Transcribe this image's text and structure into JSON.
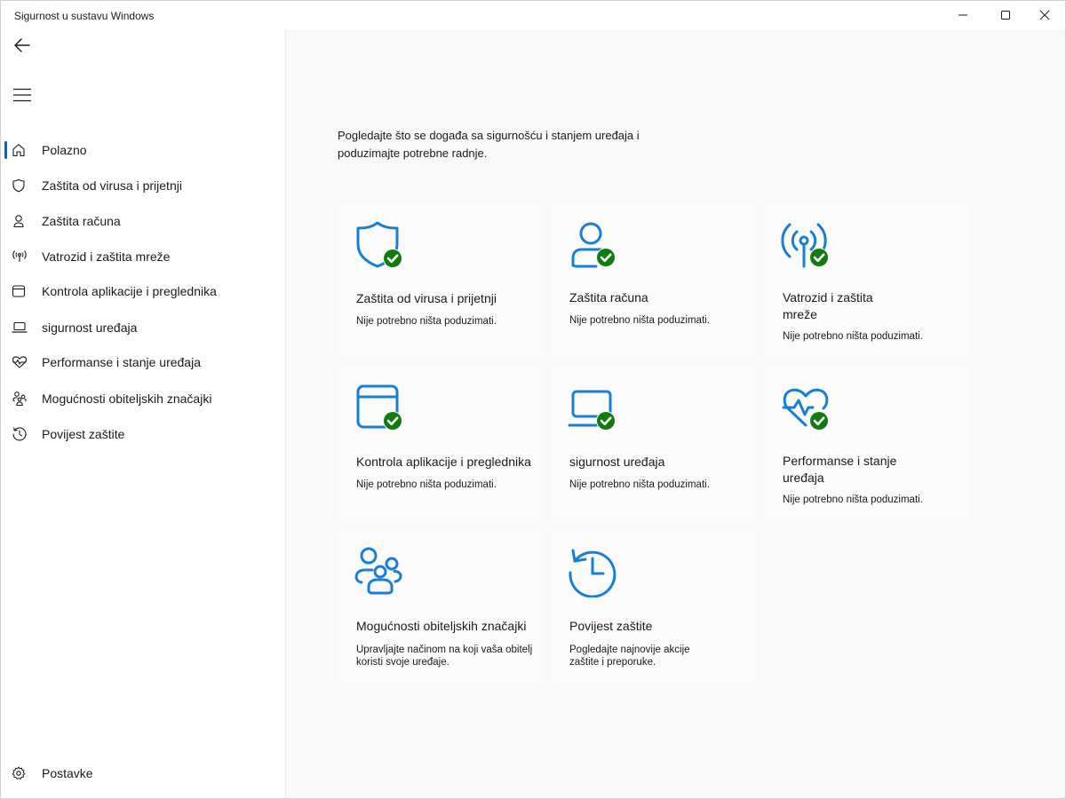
{
  "window": {
    "title": "Sigurnost u sustavu Windows"
  },
  "sidebar": {
    "items": [
      {
        "label": "Polazno",
        "icon": "home-icon"
      },
      {
        "label": "Zaštita od virusa i prijetnji",
        "icon": "shield-icon"
      },
      {
        "label": "Zaštita računa",
        "icon": "person-icon"
      },
      {
        "label": "Vatrozid i zaštita mreže",
        "icon": "antenna-icon"
      },
      {
        "label": "Kontrola aplikacije i preglednika",
        "icon": "app-window-icon"
      },
      {
        "label": "sigurnost uređaja",
        "icon": "laptop-icon"
      },
      {
        "label": "Performanse i stanje uređaja",
        "icon": "heart-pulse-icon"
      },
      {
        "label": "Mogućnosti obiteljskih značajki",
        "icon": "family-icon"
      },
      {
        "label": "Povijest zaštite",
        "icon": "history-icon"
      }
    ],
    "settings_label": "Postavke"
  },
  "main": {
    "intro": "Pogledajte što se događa sa sigurnošću i stanjem uređaja i poduzimajte potrebne radnje.",
    "tiles": [
      {
        "title": "Zaštita od virusa i prijetnji",
        "desc": "Nije potrebno ništa poduzimati.",
        "icon": "shield-check-icon"
      },
      {
        "title": "Zaštita računa",
        "desc": "Nije potrebno ništa poduzimati.",
        "icon": "person-check-icon"
      },
      {
        "title": "Vatrozid i zaštita mreže",
        "desc": "Nije potrebno ništa poduzimati.",
        "icon": "antenna-check-icon"
      },
      {
        "title": "Kontrola aplikacije i preglednika",
        "desc": "Nije potrebno ništa poduzimati.",
        "icon": "app-window-check-icon"
      },
      {
        "title": "sigurnost uređaja",
        "desc": "Nije potrebno ništa poduzimati.",
        "icon": "laptop-check-icon"
      },
      {
        "title": "Performanse i stanje uređaja",
        "desc": "Nije potrebno ništa poduzimati.",
        "icon": "heart-check-icon"
      },
      {
        "title": "Mogućnosti obiteljskih značajki",
        "desc": "Upravljajte načinom na koji vaša obitelj koristi svoje uređaje.",
        "icon": "family-icon"
      },
      {
        "title": "Povijest zaštite",
        "desc": "Pogledajte najnovije akcije zaštite i preporuke.",
        "icon": "history-icon"
      }
    ]
  },
  "colors": {
    "accent": "#0067c0",
    "icon_blue": "#1a7fd4",
    "ok_green": "#107c10"
  }
}
